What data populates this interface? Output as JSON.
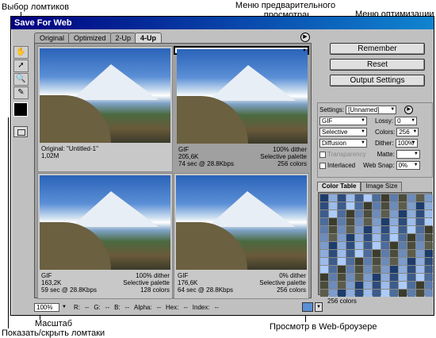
{
  "annotations": {
    "slice_select": "Выбор ломтиков",
    "preview_menu_line1": "Меню предварительного",
    "preview_menu_line2": "просмотра",
    "optimize_menu": "Меню оптимизации",
    "zoom": "Масштаб",
    "show_hide_slices": "Показать/скрыть ломтаки",
    "browser_preview": "Просмотр в Web-броузере"
  },
  "window": {
    "title": "Save For Web"
  },
  "tabs": [
    "Original",
    "Optimized",
    "2-Up",
    "4-Up"
  ],
  "active_tab": "4-Up",
  "panes": [
    {
      "l1": "Original: \"Untitled-1\"",
      "l2": "1,02M",
      "l3": "",
      "r1": "",
      "r2": "",
      "r3": ""
    },
    {
      "l1": "GIF",
      "l2": "205,6K",
      "l3": "74 sec @ 28.8Kbps",
      "r1": "100% dither",
      "r2": "Selective palette",
      "r3": "256 colors"
    },
    {
      "l1": "GIF",
      "l2": "163,2K",
      "l3": "59 sec @ 28.8Kbps",
      "r1": "100% dither",
      "r2": "Selective palette",
      "r3": "128 colors"
    },
    {
      "l1": "GIF",
      "l2": "176,6K",
      "l3": "64 sec @ 28.8Kbps",
      "r1": "0% dither",
      "r2": "Selective palette",
      "r3": "256 colors"
    }
  ],
  "buttons": {
    "remember": "Remember",
    "reset": "Reset",
    "output": "Output Settings"
  },
  "settings": {
    "label": "Settings:",
    "preset": "[Unnamed]",
    "format": "GIF",
    "lossy_label": "Lossy:",
    "lossy": "0",
    "palette": "Selective",
    "colors_label": "Colors:",
    "colors": "256",
    "dither_algo": "Diffusion",
    "dither_label": "Dither:",
    "dither": "100%",
    "transparency": "Transparency",
    "matte_label": "Matte:",
    "interlaced": "Interlaced",
    "websnap_label": "Web Snap:",
    "websnap": "0%"
  },
  "color_tabs": [
    "Color Table",
    "Image Size"
  ],
  "color_count": "256 colors",
  "bottom": {
    "zoom": "100%",
    "r": "R:",
    "r_val": "--",
    "g": "G:",
    "g_val": "--",
    "b": "B:",
    "b_val": "--",
    "alpha": "Alpha:",
    "alpha_val": "--",
    "hex": "Hex:",
    "hex_val": "--",
    "index": "Index:",
    "index_val": "--"
  },
  "palette_colors": [
    "#1c3c6c",
    "#2c4c7c",
    "#3c5c8c",
    "#4c6c9c",
    "#5c7cac",
    "#6c8cbc",
    "#7c9ccc",
    "#8cacdc",
    "#9cbcec",
    "#acccfc",
    "#3c3c2c",
    "#4c4c3c",
    "#5c5c4c"
  ]
}
